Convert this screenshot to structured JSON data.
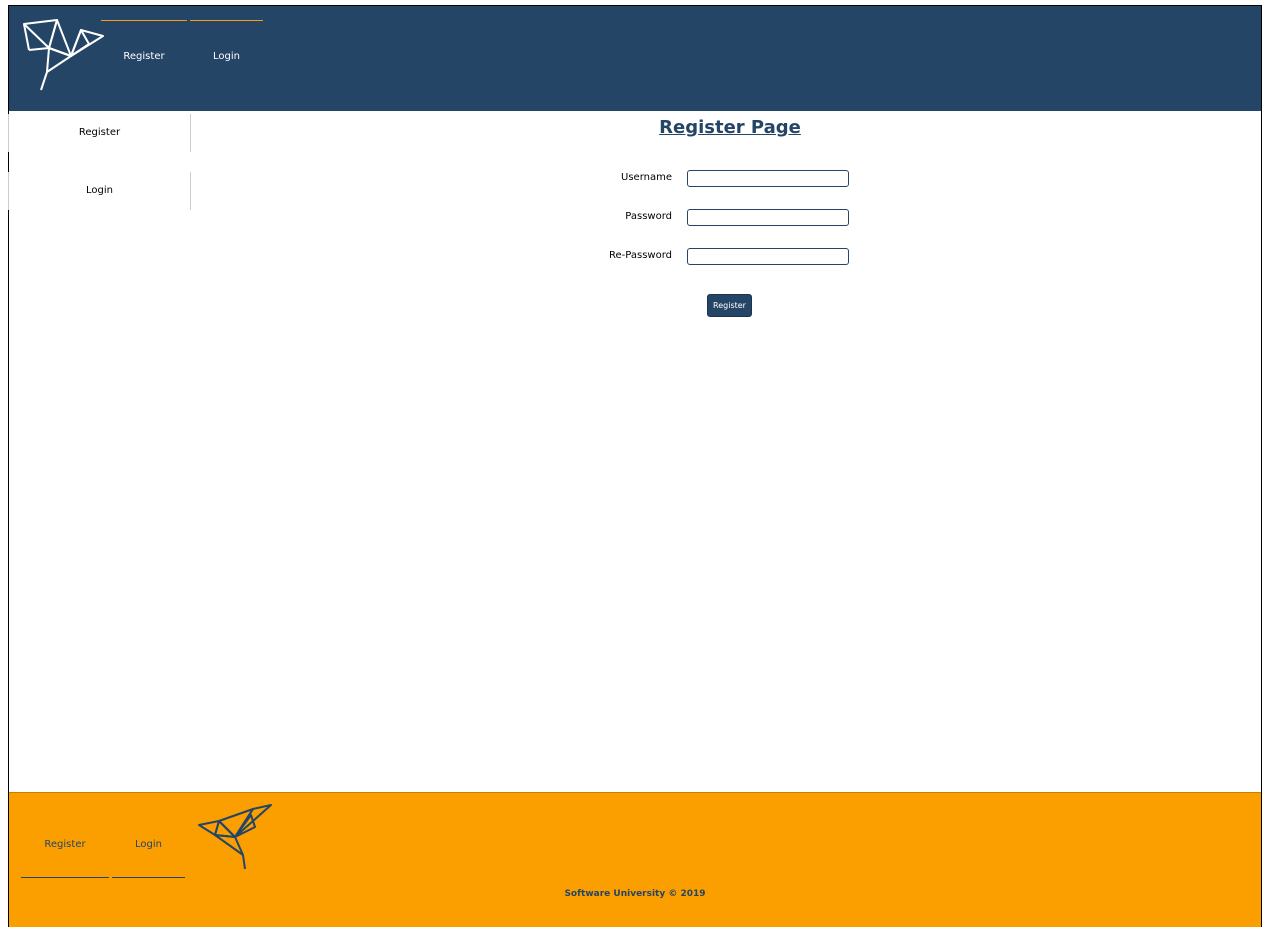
{
  "header": {
    "nav": [
      {
        "label": "Register"
      },
      {
        "label": "Login"
      }
    ],
    "logo_icon": "origami-bird-icon"
  },
  "sidebar": {
    "items": [
      {
        "label": "Register"
      },
      {
        "label": "Login"
      }
    ]
  },
  "main": {
    "title": "Register Page",
    "fields": [
      {
        "label": "Username",
        "value": "",
        "placeholder": ""
      },
      {
        "label": "Password",
        "value": "",
        "placeholder": ""
      },
      {
        "label": "Re-Password",
        "value": "",
        "placeholder": ""
      }
    ],
    "submit_label": "Register"
  },
  "footer": {
    "nav": [
      {
        "label": "Register"
      },
      {
        "label": "Login"
      }
    ],
    "copyright": "Software University © 2019",
    "logo_icon": "origami-bird-icon"
  },
  "colors": {
    "header_bg": "#254567",
    "footer_bg": "#fb9e00",
    "accent": "#f49e1a"
  }
}
